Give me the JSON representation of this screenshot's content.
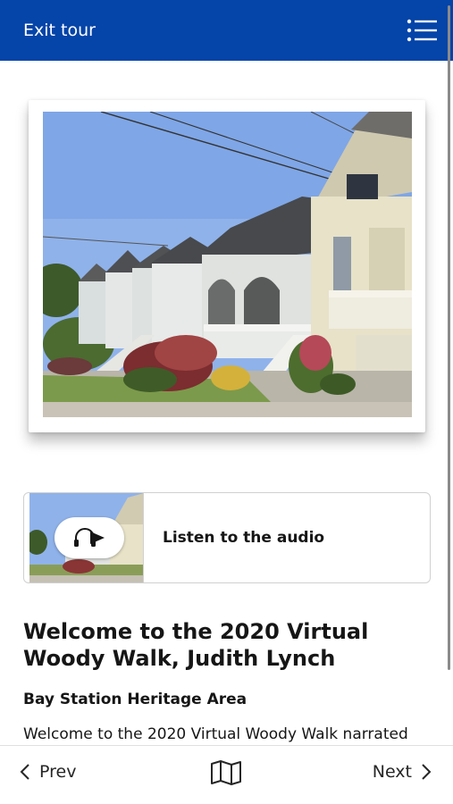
{
  "header": {
    "exit_label": "Exit tour",
    "menu_icon": "list-menu-icon",
    "background": "#0544a8"
  },
  "hero": {
    "image": "victorian-houses-photo"
  },
  "audio": {
    "label": "Listen to the audio",
    "icon": "headphones-play-icon"
  },
  "content": {
    "title": "Welcome to the 2020 Virtual Woody Walk, Judith Lynch",
    "subtitle": "Bay Station Heritage Area",
    "body": "Welcome to the 2020 Virtual Woody Walk narrated"
  },
  "footer": {
    "prev_label": "Prev",
    "next_label": "Next",
    "map_icon": "map-icon"
  }
}
